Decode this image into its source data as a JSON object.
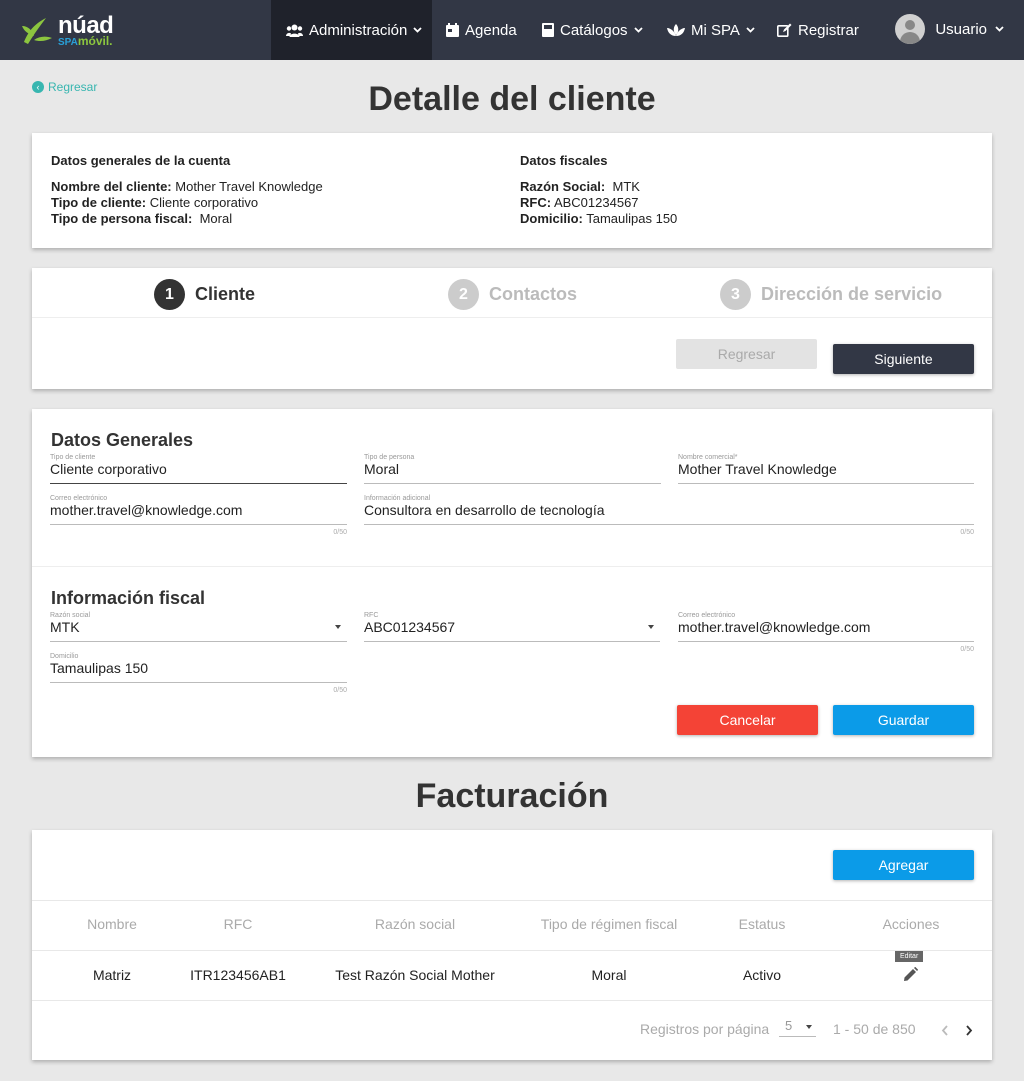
{
  "nav": {
    "brand": "núad",
    "brand_sub_spa": "SPA",
    "brand_sub": "móvil.",
    "items": [
      {
        "label": "Administración",
        "icon": "users-icon",
        "dropdown": true,
        "active": true
      },
      {
        "label": "Agenda",
        "icon": "calendar-icon",
        "dropdown": false,
        "active": false
      },
      {
        "label": "Catálogos",
        "icon": "book-icon",
        "dropdown": true,
        "active": false
      },
      {
        "label": "Mi SPA",
        "icon": "lotus-icon",
        "dropdown": true,
        "active": false
      },
      {
        "label": "Registrar",
        "icon": "edit-icon",
        "dropdown": false,
        "active": false
      }
    ],
    "user": "Usuario"
  },
  "back_label": "Regresar",
  "page_title": "Detalle del cliente",
  "summary": {
    "general_heading": "Datos generales de la cuenta",
    "client_name_label": "Nombre del cliente:",
    "client_name": "Mother Travel Knowledge",
    "client_type_label": "Tipo de cliente:",
    "client_type": "Cliente corporativo",
    "person_type_label": "Tipo de persona fiscal:",
    "person_type": "Moral",
    "fiscal_heading": "Datos fiscales",
    "razon_label": "Razón Social:",
    "razon": "MTK",
    "rfc_label": "RFC:",
    "rfc": "ABC01234567",
    "domicilio_label": "Domicilio:",
    "domicilio": "Tamaulipas 150"
  },
  "stepper": {
    "steps": [
      {
        "num": "1",
        "label": "Cliente"
      },
      {
        "num": "2",
        "label": "Contactos"
      },
      {
        "num": "3",
        "label": "Dirección de servicio"
      }
    ],
    "back_button": "Regresar",
    "next_button": "Siguiente"
  },
  "form": {
    "general_title": "Datos Generales",
    "tipo_cliente": {
      "label": "Tipo de cliente",
      "value": "Cliente corporativo"
    },
    "tipo_persona": {
      "label": "Tipo de persona",
      "value": "Moral"
    },
    "nombre_comercial": {
      "label": "Nombre comercial*",
      "value": "Mother Travel Knowledge"
    },
    "correo": {
      "label": "Correo electrónico",
      "value": "mother.travel@knowledge.com",
      "counter": "0/50"
    },
    "info_adicional": {
      "label": "Información adicional",
      "value": "Consultora en desarrollo de tecnología",
      "counter": "0/50"
    },
    "fiscal_title": "Información fiscal",
    "razon_social": {
      "label": "Razón social",
      "value": "MTK"
    },
    "rfc": {
      "label": "RFC",
      "value": "ABC01234567"
    },
    "correo_fiscal": {
      "label": "Correo electrónico",
      "value": "mother.travel@knowledge.com",
      "counter": "0/50"
    },
    "domicilio": {
      "label": "Domicilio",
      "value": "Tamaulipas 150",
      "counter": "0/50"
    },
    "cancel_button": "Cancelar",
    "save_button": "Guardar"
  },
  "billing_title": "Facturación",
  "billing": {
    "add_button": "Agregar",
    "columns": [
      "Nombre",
      "RFC",
      "Razón social",
      "Tipo de régimen fiscal",
      "Estatus",
      "Acciones"
    ],
    "rows": [
      {
        "nombre": "Matriz",
        "rfc": "ITR123456AB1",
        "razon": "Test Razón Social Mother",
        "regimen": "Moral",
        "estatus": "Activo"
      }
    ],
    "edit_tooltip": "Editar",
    "per_page_label": "Registros por página",
    "per_page": "5",
    "range": "1 - 50 de 850"
  },
  "colors": {
    "nav_bg": "#323745",
    "accent_teal": "#38b6b0",
    "primary_blue": "#0b9be8",
    "danger_red": "#f44336",
    "brand_green": "#8cc63f"
  }
}
